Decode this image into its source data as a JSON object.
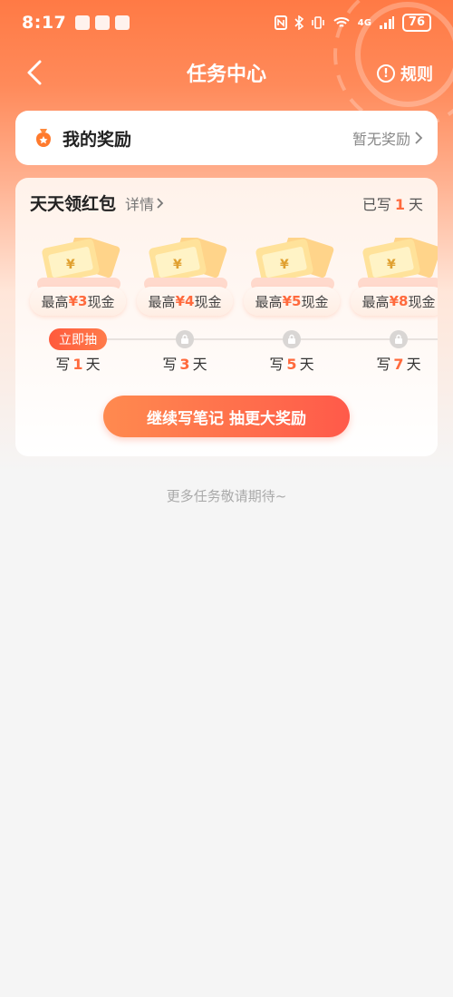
{
  "status_bar": {
    "time": "8:17",
    "network": "4G",
    "battery": "76"
  },
  "nav": {
    "title": "任务中心",
    "rules_label": "规则"
  },
  "reward_card": {
    "title": "我的奖励",
    "status": "暂无奖励"
  },
  "daily_card": {
    "title": "天天领红包",
    "detail_label": "详情",
    "written_prefix": "已写",
    "written_days": "1",
    "written_suffix": "天",
    "tiers": [
      {
        "prefix": "最高",
        "amount": "¥3",
        "suffix": "现金",
        "day_prefix": "写",
        "day": "1",
        "day_suffix": "天",
        "status": "立即抽"
      },
      {
        "prefix": "最高",
        "amount": "¥4",
        "suffix": "现金",
        "day_prefix": "写",
        "day": "3",
        "day_suffix": "天",
        "status": "locked"
      },
      {
        "prefix": "最高",
        "amount": "¥5",
        "suffix": "现金",
        "day_prefix": "写",
        "day": "5",
        "day_suffix": "天",
        "status": "locked"
      },
      {
        "prefix": "最高",
        "amount": "¥8",
        "suffix": "现金",
        "day_prefix": "写",
        "day": "7",
        "day_suffix": "天",
        "status": "locked"
      }
    ],
    "cta_label": "继续写笔记 抽更大奖励"
  },
  "more_tasks": "更多任务敬请期待~",
  "colors": {
    "accent": "#ff6a3d",
    "header_start": "#ff7a45"
  }
}
